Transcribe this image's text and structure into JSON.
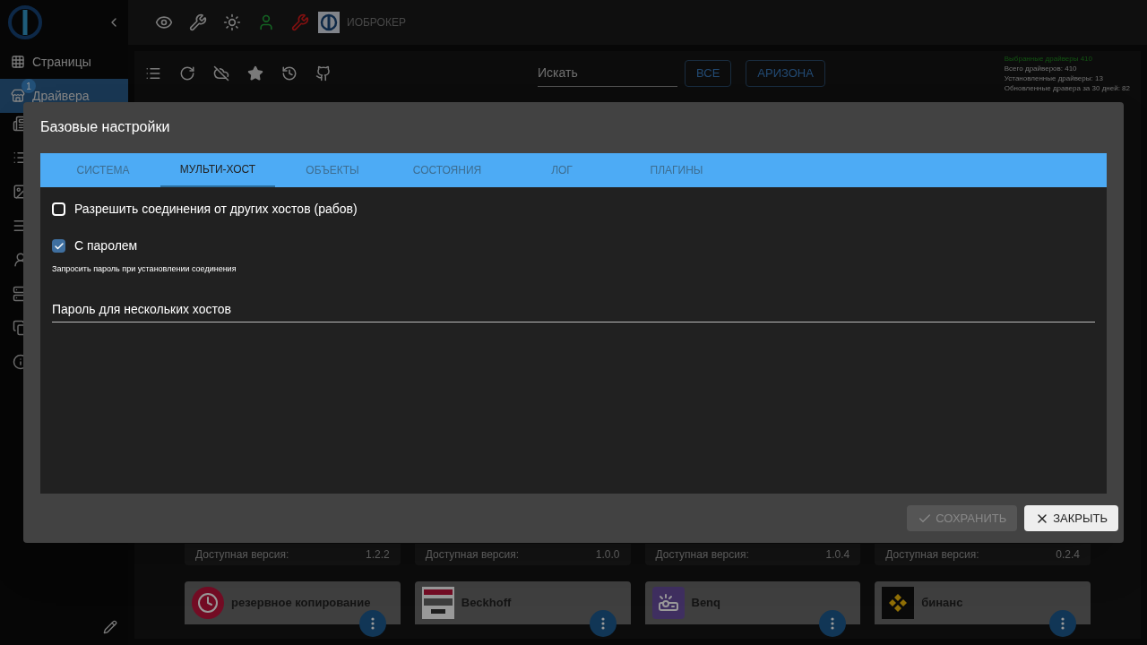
{
  "sidebar": {
    "items": [
      {
        "label": "Страницы",
        "selected": false
      },
      {
        "label": "Драйвера",
        "selected": true,
        "badge": "1"
      }
    ]
  },
  "top_bar": {
    "brand": "ИОБРОКЕР"
  },
  "toolbar": {
    "search": {
      "placeholder": "Искать"
    },
    "filters": [
      "ВСЕ",
      "АРИЗОНА"
    ],
    "stats": [
      {
        "text": "Выбранные драйверы 410",
        "kind": "highlight"
      },
      {
        "text": "Всего драйверов: 410",
        "kind": "plain"
      },
      {
        "text": "Установленные драйверы: 13",
        "kind": "plain"
      },
      {
        "text": "Обновленные дравера за 30 дней: 82",
        "kind": "plain"
      }
    ]
  },
  "cards_row": [
    {
      "label": "Доступная версия:",
      "version": "1.2.2"
    },
    {
      "label": "Доступная версия:",
      "version": "1.0.0"
    },
    {
      "label": "Доступная версия:",
      "version": "1.0.4"
    },
    {
      "label": "Доступная версия:",
      "version": "0.2.4"
    }
  ],
  "adapters": [
    {
      "name": "резервное копирование",
      "kind": "backup"
    },
    {
      "name": "Beckhoff",
      "kind": "beckhoff"
    },
    {
      "name": "Benq",
      "kind": "benq"
    },
    {
      "name": "бинанс",
      "kind": "binance"
    }
  ],
  "dialog": {
    "title": "Базовые настройки",
    "tabs": [
      {
        "label": "СИСТЕМА",
        "selected": false
      },
      {
        "label": "МУЛЬТИ-ХОСТ",
        "selected": true
      },
      {
        "label": "ОБЪЕКТЫ",
        "selected": false
      },
      {
        "label": "СОСТОЯНИЯ",
        "selected": false
      },
      {
        "label": "ЛОГ",
        "selected": false
      },
      {
        "label": "ПЛАГИНЫ",
        "selected": false
      }
    ],
    "options": [
      {
        "label": "Разрешить соединения от других хостов (рабов)",
        "checked": false
      },
      {
        "label": "С паролем",
        "checked": true,
        "hint": "Запросить пароль при установлении соединения"
      }
    ],
    "password_field": {
      "placeholder": "Пароль для нескольких хостов"
    },
    "buttons": [
      {
        "label": "СОХРАНИТЬ",
        "kind": "save",
        "disabled": true
      },
      {
        "label": "ЗАКРЫТЬ",
        "kind": "close",
        "disabled": false
      }
    ]
  }
}
